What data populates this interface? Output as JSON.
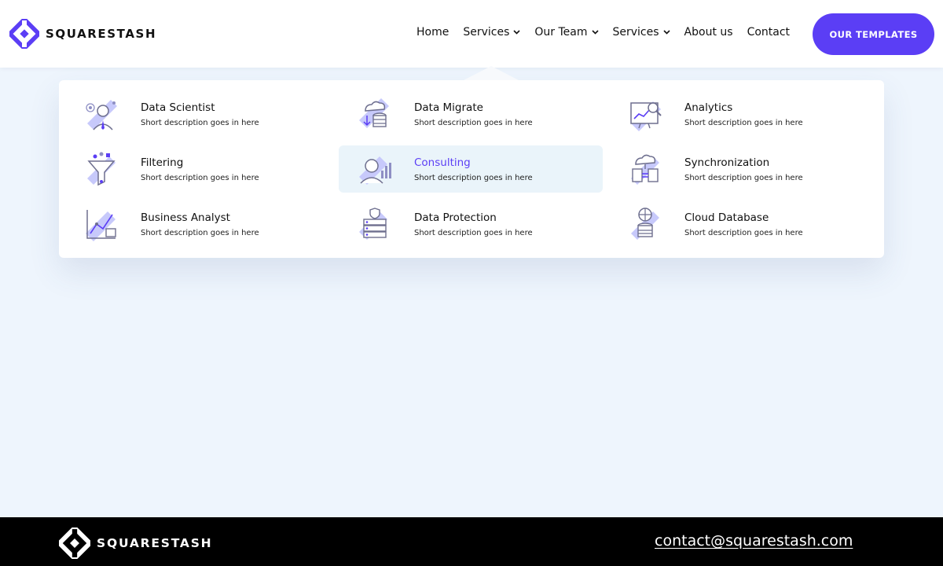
{
  "brand": {
    "name": "SQUARESTASH",
    "accent": "#5b3ef5"
  },
  "nav": {
    "items": [
      {
        "label": "Home",
        "dropdown": false
      },
      {
        "label": "Services",
        "dropdown": true
      },
      {
        "label": "Our Team",
        "dropdown": true
      },
      {
        "label": "Services",
        "dropdown": true
      },
      {
        "label": "About us",
        "dropdown": false
      },
      {
        "label": "Contact",
        "dropdown": false
      }
    ],
    "cta_label": "OUR TEMPLATES"
  },
  "mega_menu": {
    "items": [
      {
        "title": "Data Scientist",
        "desc": "Short description goes in here",
        "icon": "data-scientist-icon",
        "active": false
      },
      {
        "title": "Data Migrate",
        "desc": "Short description goes in here",
        "icon": "data-migrate-icon",
        "active": false
      },
      {
        "title": "Analytics",
        "desc": "Short description goes in here",
        "icon": "analytics-icon",
        "active": false
      },
      {
        "title": "Filtering",
        "desc": "Short description goes in here",
        "icon": "filter-icon",
        "active": false
      },
      {
        "title": "Consulting",
        "desc": "Short description goes in here",
        "icon": "consulting-icon",
        "active": true
      },
      {
        "title": "Synchronization",
        "desc": "Short description goes in here",
        "icon": "synchronization-icon",
        "active": false
      },
      {
        "title": "Business Analyst",
        "desc": "Short description goes in here",
        "icon": "business-analyst-icon",
        "active": false
      },
      {
        "title": "Data Protection",
        "desc": "Short description goes in here",
        "icon": "data-protection-icon",
        "active": false
      },
      {
        "title": "Cloud Database",
        "desc": "Short description goes in here",
        "icon": "cloud-database-icon",
        "active": false
      }
    ]
  },
  "footer": {
    "brand": "SQUARESTASH",
    "email": "contact@squarestash.com"
  }
}
